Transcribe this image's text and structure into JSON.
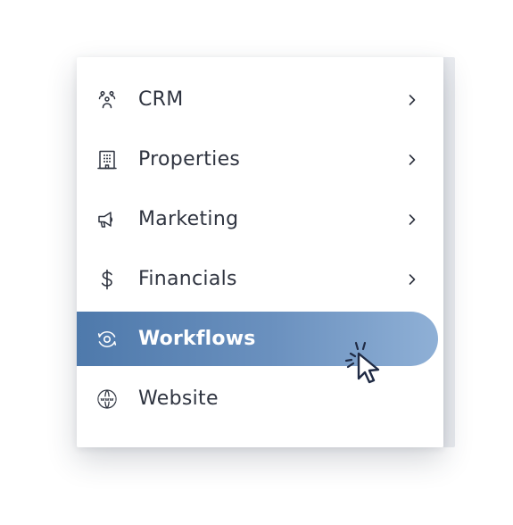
{
  "menu": {
    "items": [
      {
        "label": "CRM",
        "icon": "people-group-icon",
        "has_submenu": true,
        "active": false
      },
      {
        "label": "Properties",
        "icon": "building-icon",
        "has_submenu": true,
        "active": false
      },
      {
        "label": "Marketing",
        "icon": "megaphone-icon",
        "has_submenu": true,
        "active": false
      },
      {
        "label": "Financials",
        "icon": "dollar-icon",
        "has_submenu": true,
        "active": false
      },
      {
        "label": "Workflows",
        "icon": "workflow-eye-icon",
        "has_submenu": false,
        "active": true
      },
      {
        "label": "Website",
        "icon": "www-globe-icon",
        "has_submenu": false,
        "active": false
      }
    ]
  },
  "colors": {
    "text": "#2f3440",
    "active_gradient_start": "#4e79ab",
    "active_gradient_end": "#8fb0d6",
    "active_text": "#ffffff",
    "cursor_outline": "#2f5a8c"
  }
}
